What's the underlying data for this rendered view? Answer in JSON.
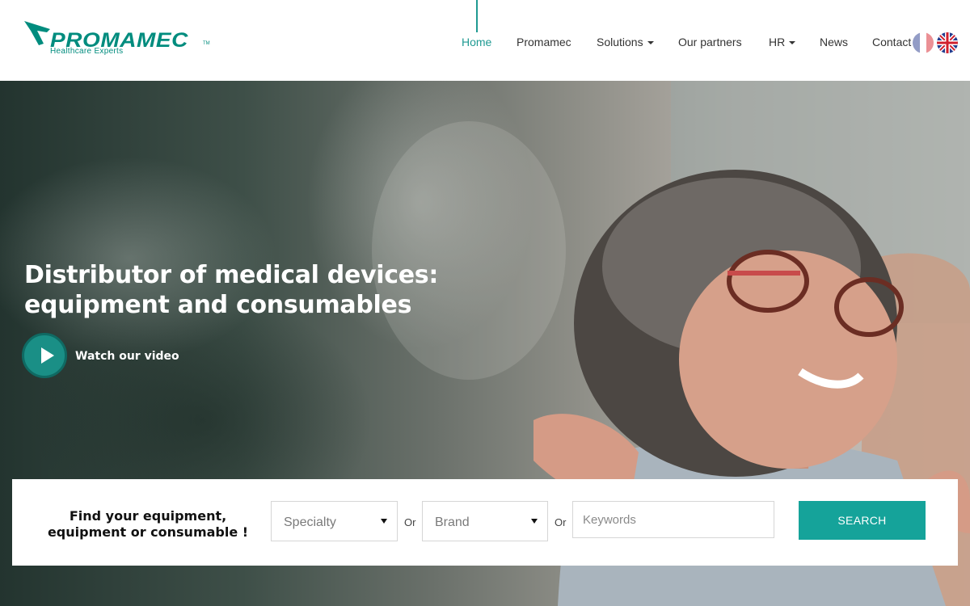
{
  "brand": {
    "name": "PROMAMEC",
    "tagline": "Healthcare Experts",
    "trademark": "TM",
    "color": "#008c7e"
  },
  "nav": {
    "items": [
      {
        "label": "Home",
        "active": true,
        "has_dropdown": false
      },
      {
        "label": "Promamec",
        "active": false,
        "has_dropdown": false
      },
      {
        "label": "Solutions",
        "active": false,
        "has_dropdown": true
      },
      {
        "label": "Our partners",
        "active": false,
        "has_dropdown": false
      },
      {
        "label": "HR",
        "active": false,
        "has_dropdown": true
      },
      {
        "label": "News",
        "active": false,
        "has_dropdown": false
      },
      {
        "label": "Contact",
        "active": false,
        "has_dropdown": false
      }
    ],
    "active_color": "#1f9a92",
    "languages": [
      {
        "icon": "france-flag-icon",
        "selected": false
      },
      {
        "icon": "uk-flag-icon",
        "selected": true
      }
    ]
  },
  "hero": {
    "title_line1": "Distributor of medical devices:",
    "title_line2": "equipment and consumables",
    "video_label": "Watch our video",
    "play_icon": "play-icon"
  },
  "search": {
    "heading_line1": "Find your equipment,",
    "heading_line2": "equipment or consumable !",
    "specialty": "Specialty",
    "brand": "Brand",
    "or": "Or",
    "keywords_placeholder": "Keywords",
    "button_label": "SEARCH",
    "button_color": "#15a39a"
  }
}
